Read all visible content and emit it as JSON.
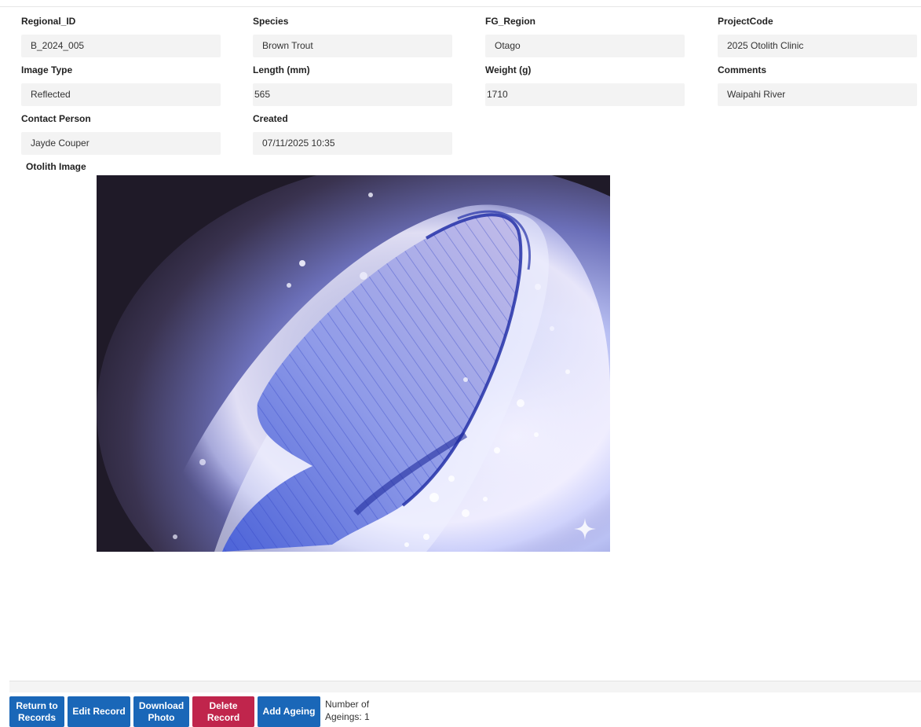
{
  "fields": {
    "regional_id": {
      "label": "Regional_ID",
      "value": "B_2024_005"
    },
    "species": {
      "label": "Species",
      "value": "Brown Trout"
    },
    "fg_region": {
      "label": "FG_Region",
      "value": "Otago"
    },
    "project_code": {
      "label": "ProjectCode",
      "value": "2025 Otolith Clinic"
    },
    "image_type": {
      "label": "Image Type",
      "value": "Reflected"
    },
    "length": {
      "label": "Length (mm)",
      "value": "565"
    },
    "weight": {
      "label": "Weight (g)",
      "value": "1710"
    },
    "comments": {
      "label": "Comments",
      "value": "Waipahi River"
    },
    "contact_person": {
      "label": "Contact Person",
      "value": "Jayde Couper"
    },
    "created": {
      "label": "Created",
      "value": "07/11/2025 10:35"
    }
  },
  "otolith": {
    "label": "Otolith Image",
    "watermark_icon": "sparkle-icon"
  },
  "actions": {
    "return_label": "Return to\nRecords",
    "edit_label": "Edit Record",
    "download_label": "Download\nPhoto",
    "delete_label": "Delete\nRecord",
    "add_ageing_label": "Add Ageing",
    "ageing_count_text": "Number of\nAgeings: 1"
  },
  "colors": {
    "primary_button": "#1a67b8",
    "danger_button": "#c0254c",
    "field_background": "#f3f3f3"
  }
}
